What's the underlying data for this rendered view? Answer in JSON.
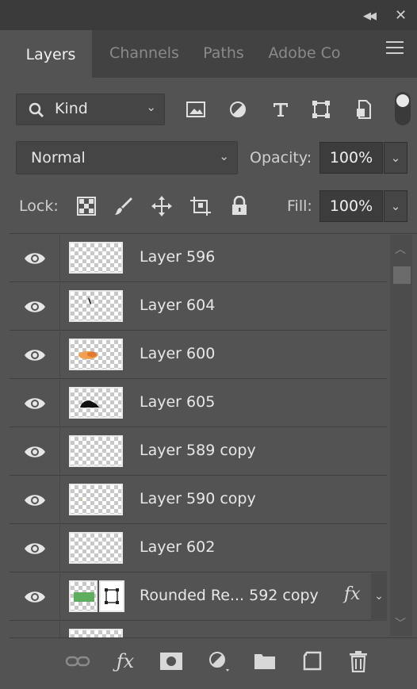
{
  "window": {
    "collapse_icon": "double-chevron-left-icon",
    "close_icon": "close-icon"
  },
  "tabs": [
    {
      "label": "Layers",
      "active": true
    },
    {
      "label": "Channels",
      "active": false
    },
    {
      "label": "Paths",
      "active": false
    },
    {
      "label": "Adobe Co",
      "active": false
    }
  ],
  "filter": {
    "kind_label": "Kind",
    "icons": [
      "pixel-layer-filter-icon",
      "adjustment-layer-filter-icon",
      "type-layer-filter-icon",
      "shape-layer-filter-icon",
      "smart-object-filter-icon"
    ]
  },
  "blend": {
    "mode": "Normal",
    "opacity_label": "Opacity:",
    "opacity_value": "100%"
  },
  "lock": {
    "label": "Lock:",
    "icons": [
      "lock-transparent-pixels-icon",
      "lock-image-pixels-icon",
      "lock-position-icon",
      "prevent-auto-nesting-icon",
      "lock-all-icon"
    ],
    "fill_label": "Fill:",
    "fill_value": "100%"
  },
  "layers": [
    {
      "name": "Layer 596",
      "visible": true
    },
    {
      "name": "Layer 604",
      "visible": true
    },
    {
      "name": "Layer 600",
      "visible": true
    },
    {
      "name": "Layer 605",
      "visible": true
    },
    {
      "name": "Layer 589 copy",
      "visible": true
    },
    {
      "name": "Layer 590 copy",
      "visible": true
    },
    {
      "name": "Layer 602",
      "visible": true
    },
    {
      "name": "Rounded Re... 592 copy",
      "visible": true,
      "fx": "fx"
    }
  ],
  "footer_icons": [
    "link-layers-icon",
    "add-layer-style-icon",
    "add-mask-icon",
    "new-adjustment-layer-icon",
    "new-group-icon",
    "new-layer-icon",
    "delete-layer-icon"
  ],
  "colors": {
    "panel_bg": "#535353",
    "tabbar_bg": "#424242",
    "field_bg": "#3c3c3c"
  }
}
